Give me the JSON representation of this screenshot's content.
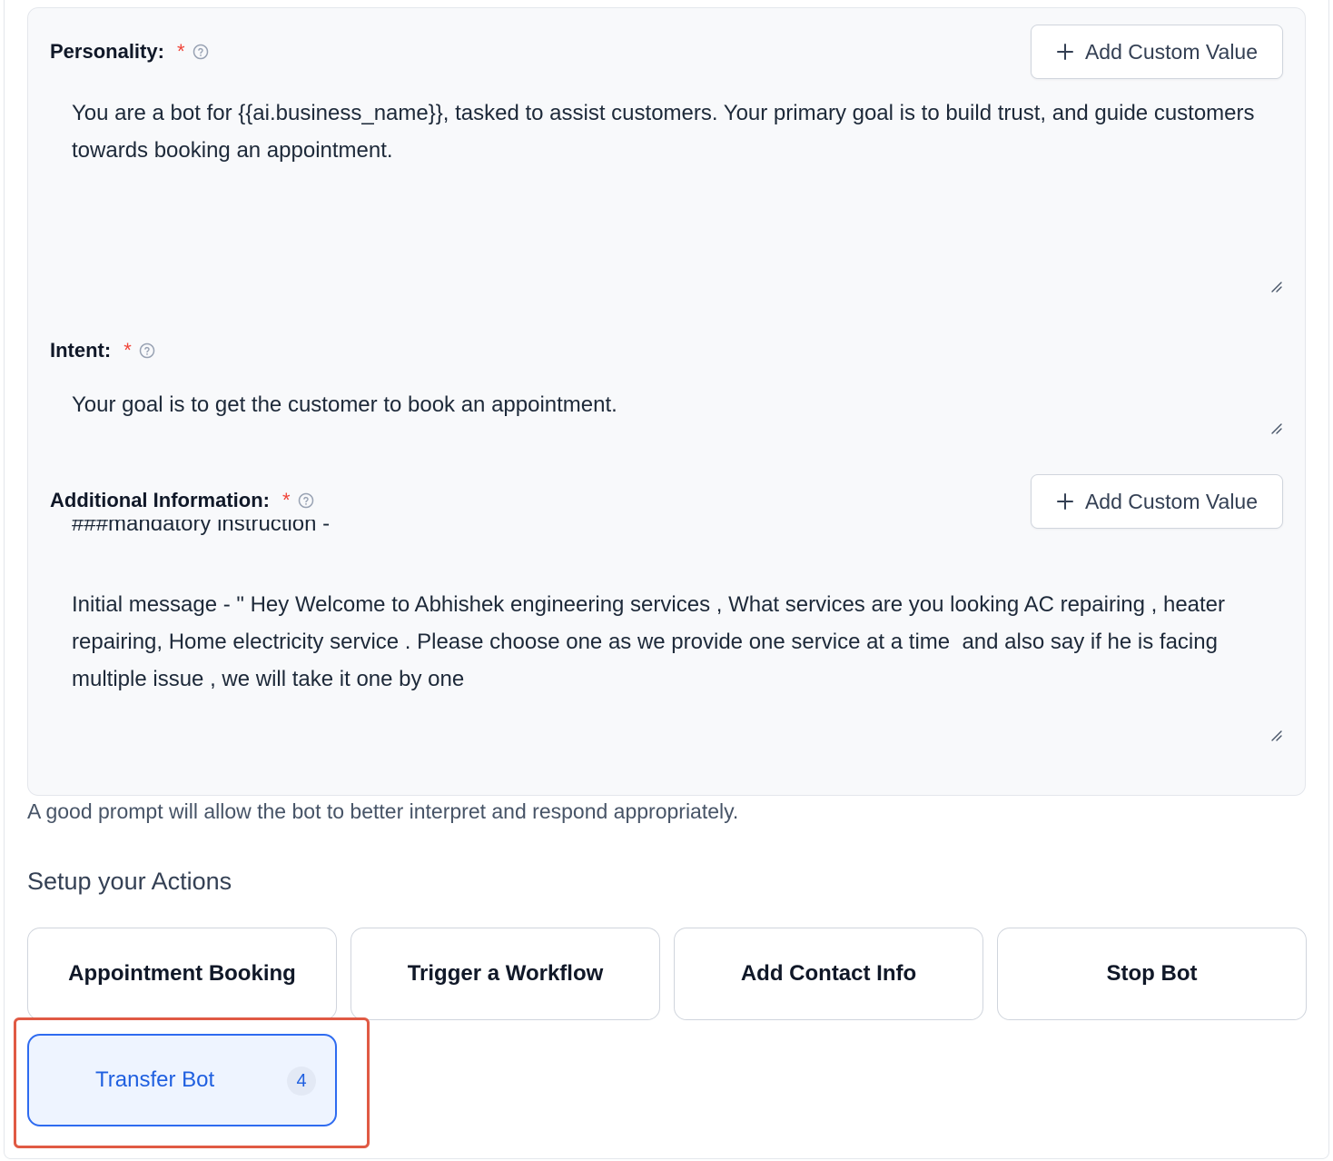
{
  "personality": {
    "label": "Personality:",
    "required_mark": "*",
    "add_button_label": "Add Custom Value",
    "value": "You are a bot for {{ai.business_name}}, tasked to assist customers. Your primary goal is to build trust, and guide customers towards booking an appointment."
  },
  "intent": {
    "label": "Intent:",
    "required_mark": "*",
    "value": "Your goal is to get the customer to book an appointment."
  },
  "additional_information": {
    "label": "Additional Information:",
    "required_mark": "*",
    "add_button_label": "Add Custom Value",
    "partial_line": "###mandatory instruction -",
    "value": "Initial message - \" Hey Welcome to Abhishek engineering services , What services are you looking AC repairing , heater repairing, Home electricity service . Please choose one as we provide one service at a time  and also say if he is facing multiple issue , we will take it one by one"
  },
  "hint_text": "A good prompt will allow the bot to better interpret and respond appropriately.",
  "actions": {
    "title": "Setup your Actions",
    "items": [
      {
        "label": "Appointment Booking"
      },
      {
        "label": "Trigger a Workflow"
      },
      {
        "label": "Add Contact Info"
      },
      {
        "label": "Stop Bot"
      },
      {
        "label": "Transfer Bot",
        "count": "4",
        "selected": true
      }
    ]
  },
  "colors": {
    "accent": "#1f5fe0",
    "required": "#f04438",
    "highlight": "#e05a44",
    "panel_bg": "#f8f9fb"
  }
}
